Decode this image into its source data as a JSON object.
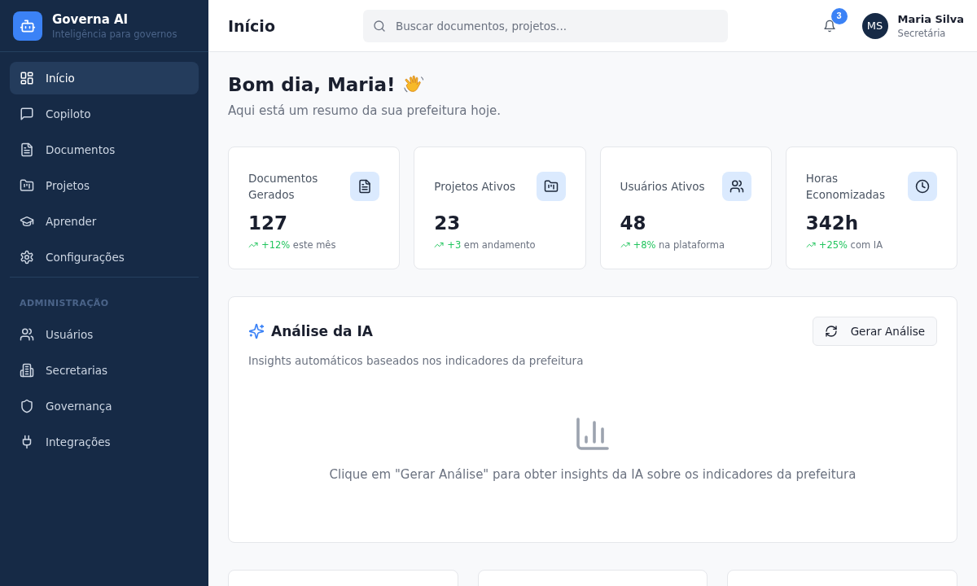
{
  "sidebar": {
    "brand": {
      "name": "Governa AI",
      "tagline": "Inteligência para governos"
    },
    "nav": [
      {
        "label": "Início",
        "selected": true
      },
      {
        "label": "Copiloto",
        "selected": false
      },
      {
        "label": "Documentos",
        "selected": false
      },
      {
        "label": "Projetos",
        "selected": false
      },
      {
        "label": "Aprender",
        "selected": false
      },
      {
        "label": "Configurações",
        "selected": false
      }
    ],
    "section_label": "ADMINISTRAÇÃO",
    "admin_nav": [
      {
        "label": "Usuários",
        "selected": false
      },
      {
        "label": "Secretarias",
        "selected": false
      },
      {
        "label": "Governança",
        "selected": false
      },
      {
        "label": "Integrações",
        "selected": false
      }
    ]
  },
  "header": {
    "title": "Início",
    "search": {
      "placeholder": "Buscar documentos, projetos..."
    },
    "notifications": {
      "count": "3"
    },
    "user": {
      "initials": "MS",
      "name": "Maria Silva",
      "role": "Secretária"
    }
  },
  "greeting": {
    "title": "Bom dia, Maria!",
    "subtitle": "Aqui está um resumo da sua prefeitura hoje."
  },
  "stats": [
    {
      "label": "Documentos Gerados",
      "value": "127",
      "change": "+12%",
      "note": "este mês"
    },
    {
      "label": "Projetos Ativos",
      "value": "23",
      "change": "+3",
      "note": "em andamento"
    },
    {
      "label": "Usuários Ativos",
      "value": "48",
      "change": "+8%",
      "note": "na plataforma"
    },
    {
      "label": "Horas Economizadas",
      "value": "342h",
      "change": "+25%",
      "note": "com IA"
    }
  ],
  "analysis": {
    "title": "Análise da IA",
    "button": "Gerar Análise",
    "subtitle": "Insights automáticos baseados nos indicadores da prefeitura",
    "empty_message": "Clique em \"Gerar Análise\" para obter insights da IA sobre os indicadores da prefeitura"
  }
}
